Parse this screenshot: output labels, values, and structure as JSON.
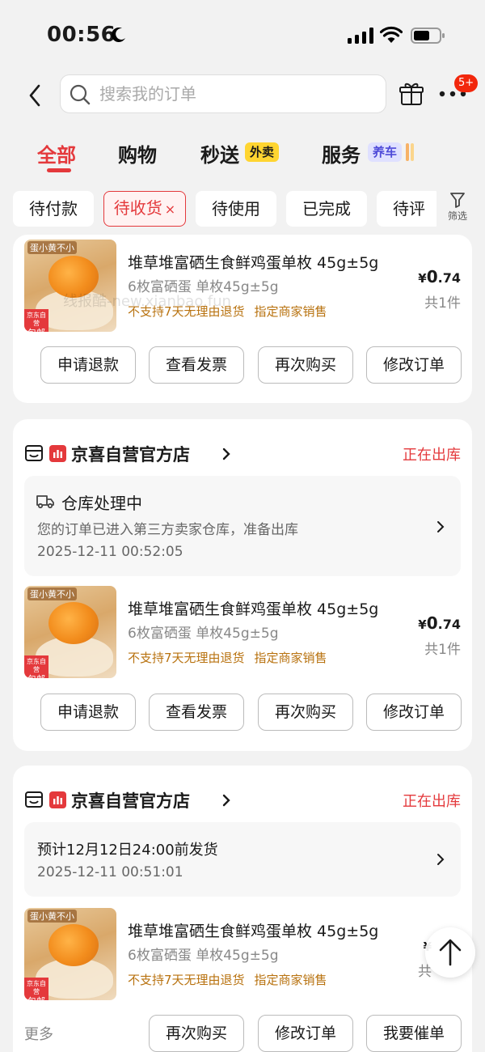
{
  "status_bar": {
    "time": "00:56"
  },
  "header": {
    "search_placeholder": "搜索我的订单",
    "badge": "5+"
  },
  "tabs": [
    {
      "label": "全部"
    },
    {
      "label": "购物"
    },
    {
      "label": "秒送",
      "tag": "外卖"
    },
    {
      "label": "服务",
      "tag": "养车"
    }
  ],
  "filters": {
    "chips": [
      "待付款",
      "待收货",
      "待使用",
      "已完成",
      "待评"
    ],
    "close": "×",
    "filter_label": "筛选"
  },
  "watermark": "线报酷-new.xianbao.fun",
  "colors": {
    "accent": "#e4393c",
    "tag_orange": "#b8720f"
  },
  "orders": [
    {
      "product": {
        "thumb_title": "蛋小黄不小",
        "thumb_badge_top": "京东自营",
        "thumb_badge_bottom": "包邮",
        "title": "堆草堆富硒生食鲜鸡蛋单枚 45g±5g",
        "spec": "6枚富硒蛋 单枚45g±5g",
        "tag1": "不支持7天无理由退货",
        "tag2": "指定商家销售",
        "price_yen": "¥",
        "price_int": "0",
        "price_dec": ".74",
        "qty": "共1件"
      },
      "actions": [
        "申请退款",
        "查看发票",
        "再次购买",
        "修改订单"
      ]
    },
    {
      "shop_name": "京喜自营官方店",
      "status": "正在出库",
      "info": {
        "title": "仓库处理中",
        "desc": "您的订单已进入第三方卖家仓库，准备出库",
        "time": "2025-12-11 00:52:05"
      },
      "product": {
        "thumb_title": "蛋小黄不小",
        "thumb_badge_top": "京东自营",
        "thumb_badge_bottom": "包邮",
        "title": "堆草堆富硒生食鲜鸡蛋单枚 45g±5g",
        "spec": "6枚富硒蛋 单枚45g±5g",
        "tag1": "不支持7天无理由退货",
        "tag2": "指定商家销售",
        "price_yen": "¥",
        "price_int": "0",
        "price_dec": ".74",
        "qty": "共1件"
      },
      "actions": [
        "申请退款",
        "查看发票",
        "再次购买",
        "修改订单"
      ]
    },
    {
      "shop_name": "京喜自营官方店",
      "status": "正在出库",
      "info": {
        "title": "预计12月12日24:00前发货",
        "time": "2025-12-11 00:51:01"
      },
      "product": {
        "thumb_title": "蛋小黄不小",
        "thumb_badge_top": "京东自营",
        "thumb_badge_bottom": "包邮",
        "title": "堆草堆富硒生食鲜鸡蛋单枚 45g±5g",
        "spec": "6枚富硒蛋 单枚45g±5g",
        "tag1": "不支持7天无理由退货",
        "tag2": "指定商家销售",
        "price_yen": "¥",
        "qty": "共"
      },
      "more": "更多",
      "actions": [
        "再次购买",
        "修改订单",
        "我要催单"
      ]
    }
  ]
}
